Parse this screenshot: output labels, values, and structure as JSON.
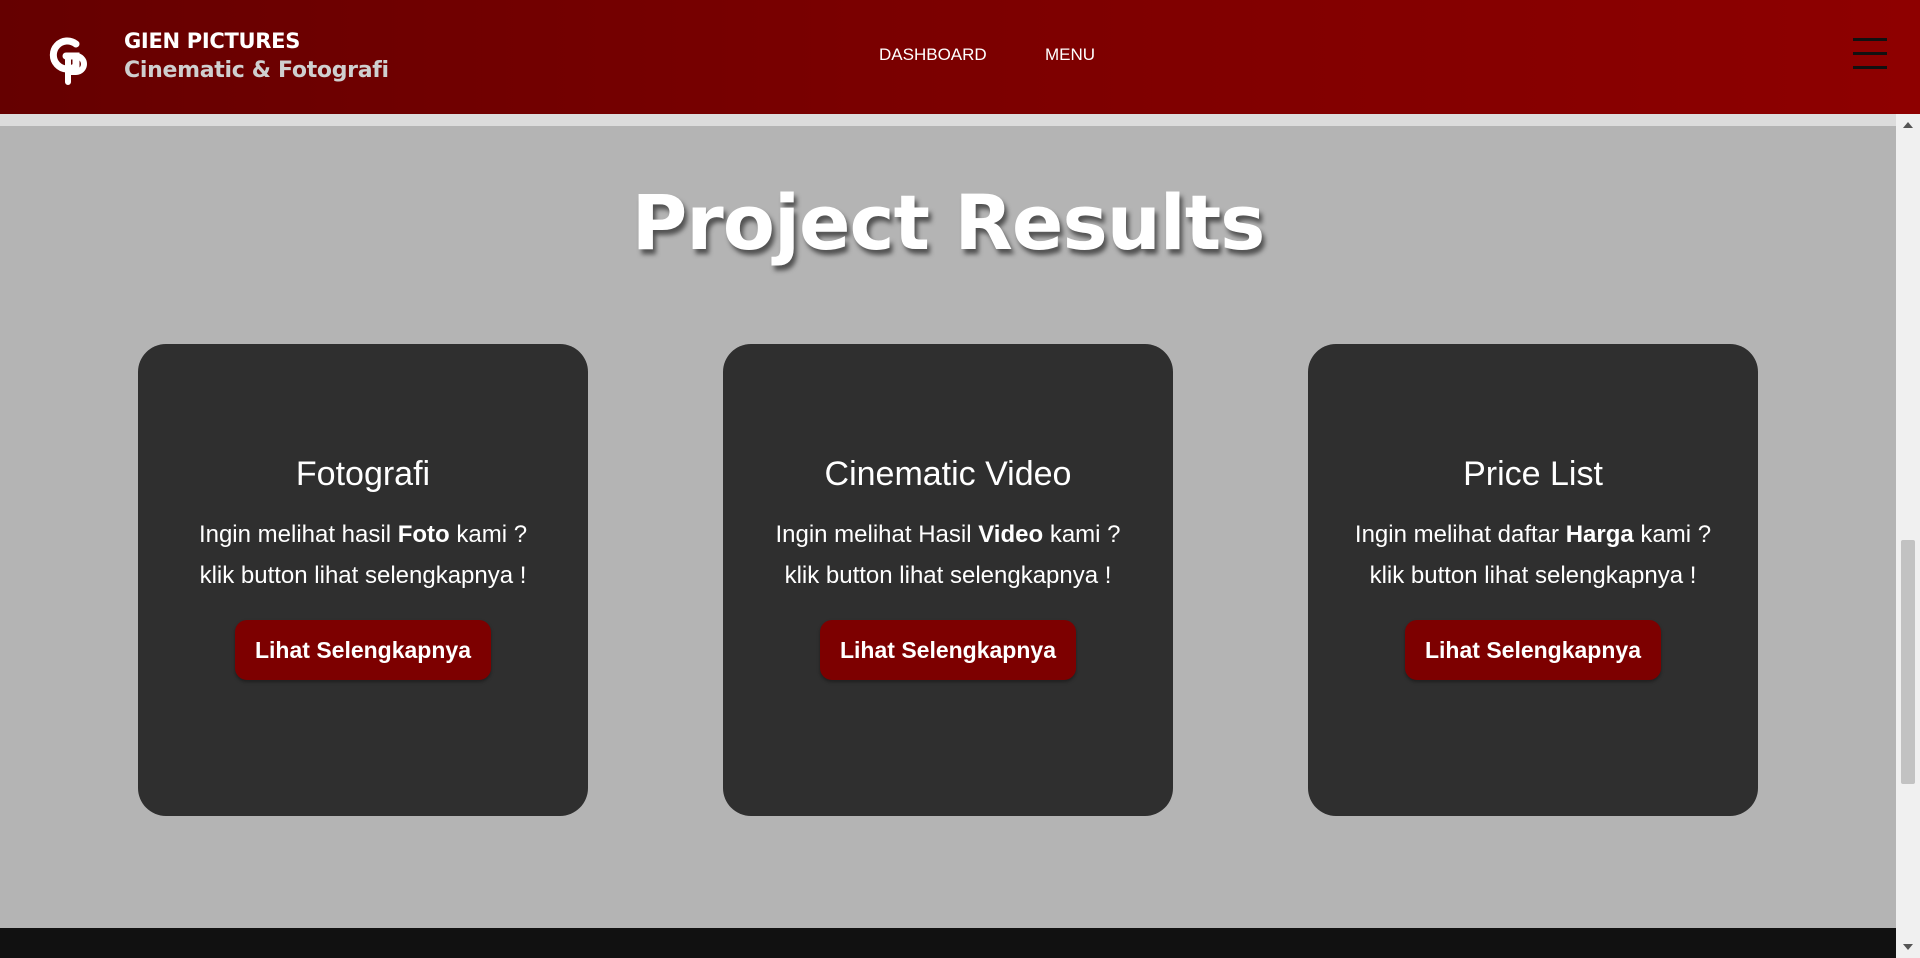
{
  "header": {
    "brand_name": "GIEN PICTURES",
    "brand_tagline": "Cinematic & Fotografi",
    "nav": [
      {
        "label": "DASHBOARD"
      },
      {
        "label": "MENU"
      }
    ],
    "logo_letters": "GP"
  },
  "main": {
    "title": "Project Results",
    "cards": [
      {
        "title": "Fotografi",
        "line1_pre": "Ingin melihat hasil ",
        "line1_bold": "Foto",
        "line1_post": " kami ?",
        "line2": "klik button lihat selengkapnya !",
        "button": "Lihat Selengkapnya"
      },
      {
        "title": "Cinematic Video",
        "line1_pre": "Ingin melihat Hasil ",
        "line1_bold": "Video",
        "line1_post": " kami ?",
        "line2": "klik button lihat selengkapnya !",
        "button": "Lihat Selengkapnya"
      },
      {
        "title": "Price List",
        "line1_pre": "Ingin melihat daftar ",
        "line1_bold": "Harga",
        "line1_post": " kami ?",
        "line2": "klik button lihat selengkapnya !",
        "button": "Lihat Selengkapnya"
      }
    ]
  },
  "colors": {
    "header_gradient_start": "#650000",
    "header_gradient_end": "#8e0000",
    "page_background": "#b4b4b4",
    "card_background": "#2f2f2f",
    "button_background": "#7d0000",
    "footer_background": "#111111"
  },
  "icons": [
    "gp-logo-icon",
    "hamburger-menu-icon"
  ]
}
